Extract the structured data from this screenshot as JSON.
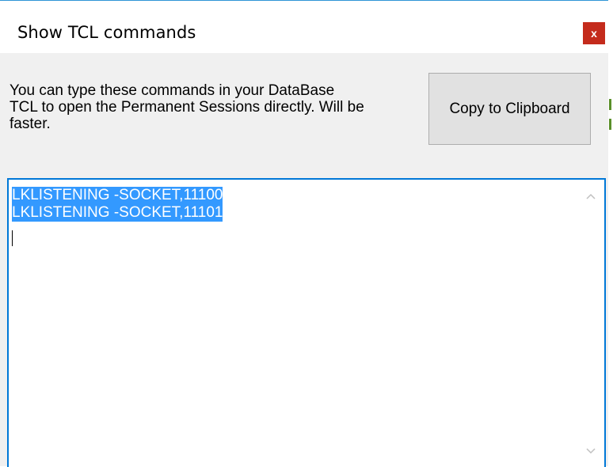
{
  "window": {
    "title": "Show TCL commands",
    "close_label": "x"
  },
  "dialog": {
    "description": "You can type these commands in your DataBase\nTCL to open the Permanent Sessions directly. Will be\nfaster.",
    "copy_button_label": "Copy to Clipboard"
  },
  "commands": {
    "lines": [
      "LKLISTENING -SOCKET,11100",
      "LKLISTENING -SOCKET,11101"
    ]
  },
  "colors": {
    "accent": "#0078d7",
    "selection": "#3399ff",
    "close_button": "#c42b1c"
  },
  "icons": {
    "scroll_up": "chevron-up-icon",
    "scroll_down": "chevron-down-icon",
    "close": "close-icon"
  }
}
